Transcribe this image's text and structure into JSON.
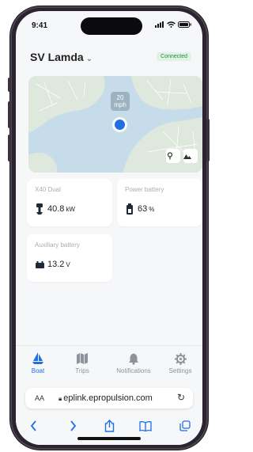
{
  "status_bar": {
    "time": "9:41"
  },
  "header": {
    "title": "SV Lamda",
    "chevron": "⌄",
    "connection_status": "Connected"
  },
  "colors": {
    "accent": "#1f6fe5",
    "connected": "#1e8f3e"
  },
  "map": {
    "speed_value": "20",
    "speed_unit": "mph",
    "buttons": [
      "marker-pin-icon",
      "terrain-icon"
    ]
  },
  "cards": {
    "motor": {
      "label": "X40 Dual",
      "value": "40.8",
      "unit": "kW",
      "icon": "motor-icon"
    },
    "power_battery": {
      "label": "Power battery",
      "value": "63",
      "unit": "%",
      "icon": "battery-icon"
    },
    "aux_battery": {
      "label": "Auxiliary battery",
      "value": "13.2",
      "unit": "V",
      "icon": "car-battery-icon"
    }
  },
  "tabs": [
    {
      "label": "Boat",
      "icon": "sailboat-icon",
      "active": true
    },
    {
      "label": "Trips",
      "icon": "map-icon",
      "active": false
    },
    {
      "label": "Notifications",
      "icon": "bell-icon",
      "active": false
    },
    {
      "label": "Settings",
      "icon": "gear-icon",
      "active": false
    }
  ],
  "browser": {
    "text_size_label": "AA",
    "url": "eplink.epropulsion.com",
    "toolbar": [
      "back-icon",
      "forward-icon",
      "share-icon",
      "bookmarks-icon",
      "tabs-icon"
    ]
  }
}
